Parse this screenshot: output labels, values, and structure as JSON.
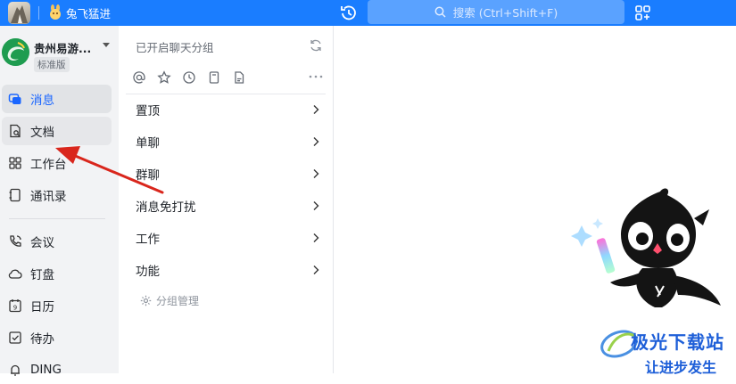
{
  "topbar": {
    "user_name": "兔飞猛进",
    "search_placeholder": "搜索 (Ctrl+Shift+F)",
    "accent": "#1a7dff"
  },
  "org": {
    "name": "贵州易游...",
    "badge": "标准版"
  },
  "nav": {
    "items": [
      {
        "label": "消息",
        "icon": "message-icon",
        "state": "active"
      },
      {
        "label": "文档",
        "icon": "document-icon",
        "state": "hover"
      },
      {
        "label": "工作台",
        "icon": "workbench-grid-icon"
      },
      {
        "label": "通讯录",
        "icon": "contacts-icon"
      },
      {
        "label": "会议",
        "icon": "phone-meeting-icon"
      },
      {
        "label": "钉盘",
        "icon": "cloud-drive-icon"
      },
      {
        "label": "日历",
        "icon": "calendar-icon"
      },
      {
        "label": "待办",
        "icon": "todo-check-icon"
      },
      {
        "label": "DING",
        "icon": "ding-bell-icon"
      }
    ]
  },
  "group_panel": {
    "title": "已开启聊天分组",
    "filter_icons": [
      "at-mention-icon",
      "star-icon",
      "clock-icon",
      "bookmark-icon",
      "file-icon"
    ],
    "groups": [
      {
        "label": "置顶"
      },
      {
        "label": "单聊"
      },
      {
        "label": "群聊"
      },
      {
        "label": "消息免打扰"
      },
      {
        "label": "工作"
      },
      {
        "label": "功能"
      }
    ],
    "manage_label": "分组管理"
  },
  "watermark": {
    "line1": "极光下载站",
    "line2": "让进步发生"
  }
}
